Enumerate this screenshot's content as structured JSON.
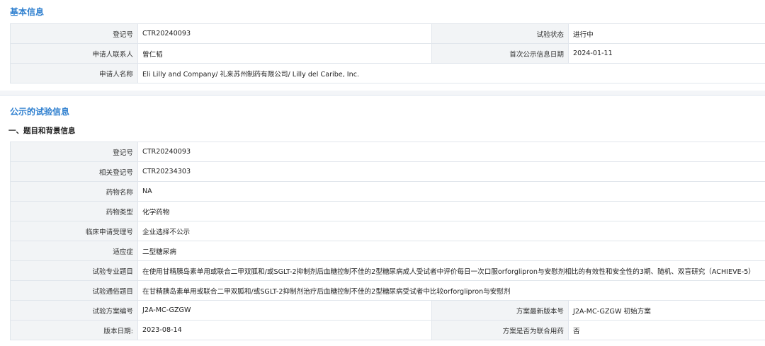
{
  "basic": {
    "title": "基本信息",
    "rows": [
      {
        "l1": "登记号",
        "v1": "CTR20240093",
        "l2": "试验状态",
        "v2": "进行中"
      },
      {
        "l1": "申请人联系人",
        "v1": "曾仁韬",
        "l2": "首次公示信息日期",
        "v2": "2024-01-11"
      }
    ],
    "applicant_label": "申请人名称",
    "applicant_value": "Eli Lilly and Company/ 礼来苏州制药有限公司/ Lilly del Caribe, Inc."
  },
  "public": {
    "title": "公示的试验信息",
    "subtitle": "一、题目和背景信息",
    "single_rows": [
      {
        "label": "登记号",
        "value": "CTR20240093"
      },
      {
        "label": "相关登记号",
        "value": "CTR20234303"
      },
      {
        "label": "药物名称",
        "value": "NA"
      },
      {
        "label": "药物类型",
        "value": "化学药物"
      },
      {
        "label": "临床申请受理号",
        "value": "企业选择不公示"
      },
      {
        "label": "适应症",
        "value": "二型糖尿病"
      },
      {
        "label": "试验专业题目",
        "value": "在使用甘精胰岛素单用或联合二甲双胍和/或SGLT-2抑制剂后血糖控制不佳的2型糖尿病成人受试者中评价每日一次口服orforglipron与安慰剂相比的有效性和安全性的3期、随机、双盲研究（ACHIEVE-5）"
      },
      {
        "label": "试验通俗题目",
        "value": "在甘精胰岛素单用或联合二甲双胍和/或SGLT-2抑制剂治疗后血糖控制不佳的2型糖尿病受试者中比较orforglipron与安慰剂"
      }
    ],
    "double_rows": [
      {
        "l1": "试验方案编号",
        "v1": "J2A-MC-GZGW",
        "l2": "方案最新版本号",
        "v2": "J2A-MC-GZGW 初始方案"
      },
      {
        "l1": "版本日期:",
        "v1": "2023-08-14",
        "l2": "方案是否为联合用药",
        "v2": "否"
      }
    ]
  }
}
